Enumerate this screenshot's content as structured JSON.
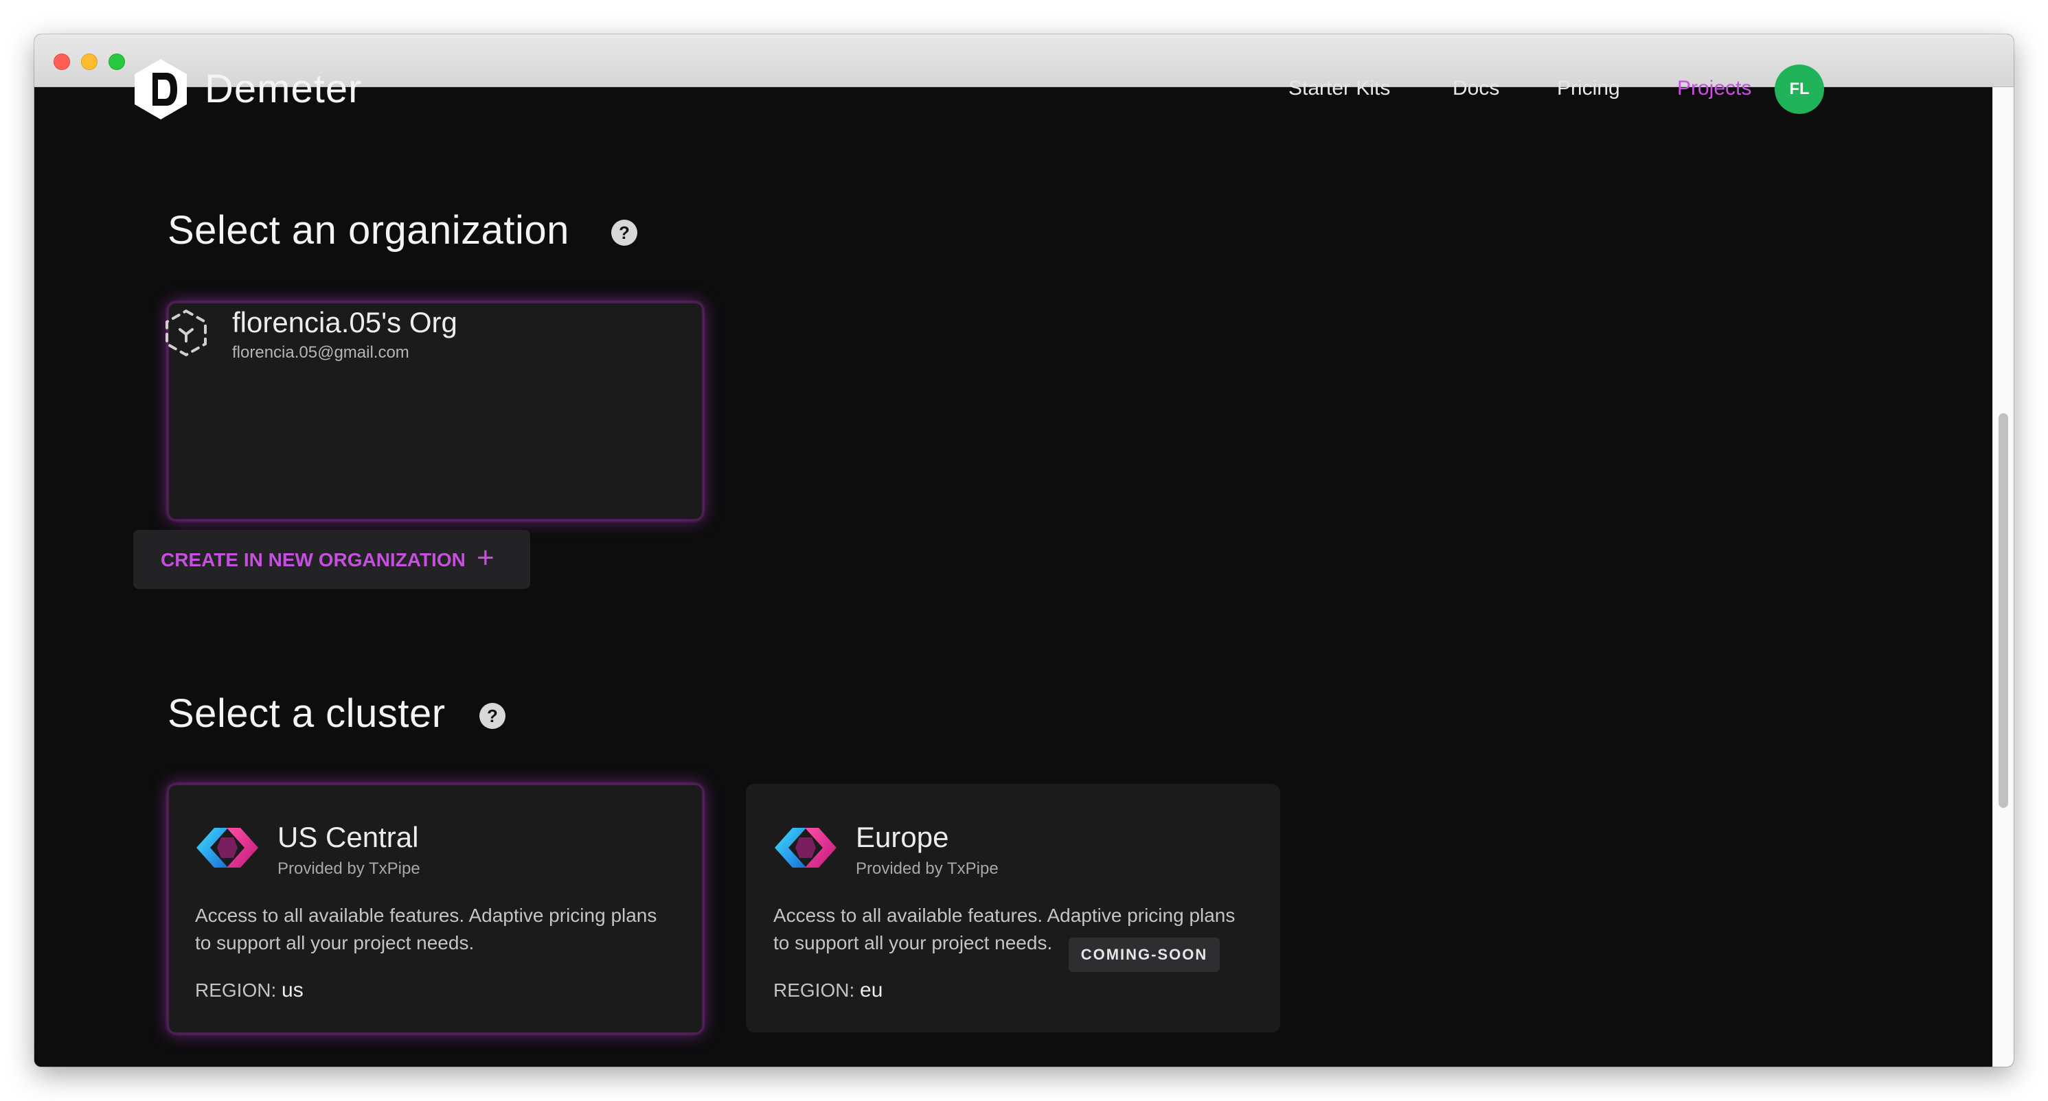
{
  "header": {
    "brand": "Demeter",
    "nav": [
      {
        "label": "Starter Kits"
      },
      {
        "label": "Docs"
      },
      {
        "label": "Pricing"
      },
      {
        "label": "Projects",
        "active": true
      }
    ],
    "avatar_initials": "FL"
  },
  "org_section": {
    "title": "Select an organization",
    "help": "?",
    "org": {
      "name": "florencia.05's Org",
      "email": "florencia.05@gmail.com",
      "selected": true
    },
    "create_button": {
      "label": "CREATE IN NEW ORGANIZATION",
      "icon": "+"
    }
  },
  "cluster_section": {
    "title": "Select a cluster",
    "help": "?",
    "clusters": [
      {
        "name": "US Central",
        "provider": "Provided by TxPipe",
        "description": "Access to all available features. Adaptive pricing plans to support all your project needs.",
        "region_label": "REGION:",
        "region": "us",
        "selected": true
      },
      {
        "name": "Europe",
        "provider": "Provided by TxPipe",
        "description": "Access to all available features. Adaptive pricing plans to support all your project needs.",
        "region_label": "REGION:",
        "region": "eu",
        "badge": "COMING-SOON"
      }
    ]
  },
  "colors": {
    "background": "#0d0d0e",
    "card": "#1b1b1c",
    "accent": "#c950e3",
    "avatar": "#21b35a"
  }
}
